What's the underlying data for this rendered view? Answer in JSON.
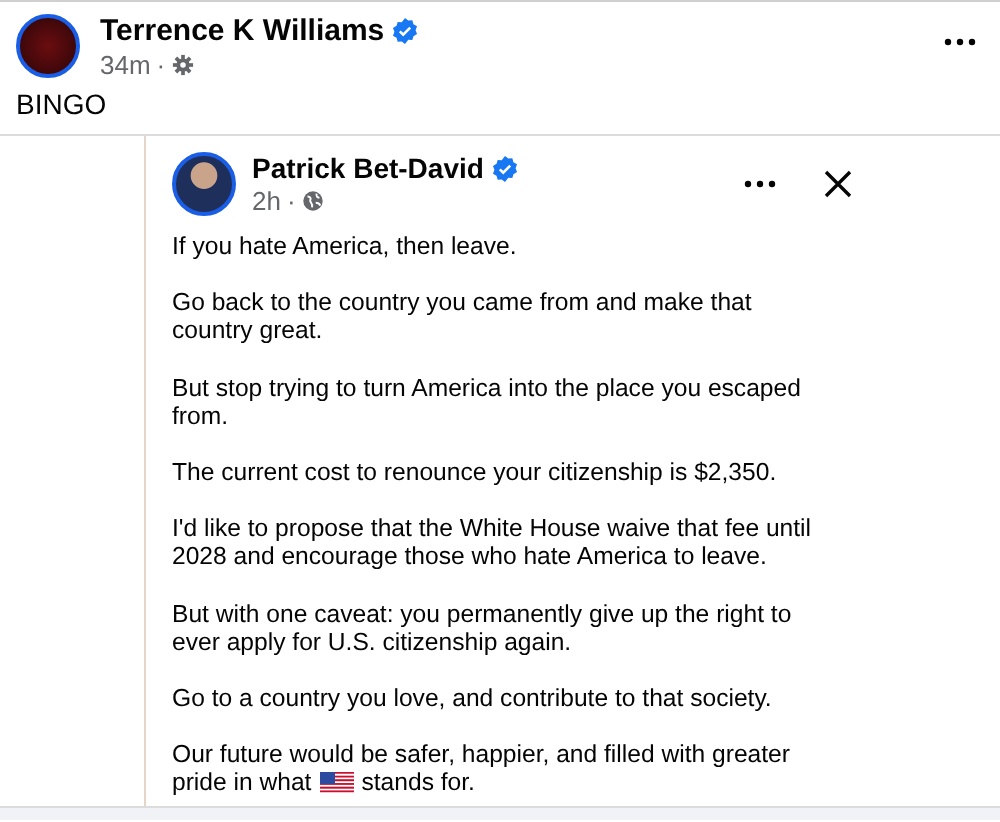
{
  "post": {
    "author": "Terrence K Williams",
    "verified": true,
    "time": "34m",
    "separator": "·",
    "text": "BINGO"
  },
  "shared_post": {
    "author": "Patrick Bet-David",
    "verified": true,
    "time": "2h",
    "separator": "·",
    "paragraphs": [
      {
        "kind": "text",
        "text": "If you hate America, then leave."
      },
      {
        "kind": "text",
        "text": "Go back to the country you came from and make that country great."
      },
      {
        "kind": "text",
        "text": "But stop trying to turn America into the place you escaped from."
      },
      {
        "kind": "text",
        "text": "The current cost to renounce your citizenship is $2,350."
      },
      {
        "kind": "text",
        "text": "I'd like to propose that the White House waive that fee until 2028 and encourage those who hate America to leave."
      },
      {
        "kind": "text",
        "text": "But with one caveat: you permanently give up the right to ever apply for U.S. citizenship again."
      },
      {
        "kind": "text",
        "text": "Go to a country you love, and contribute to that society."
      },
      {
        "kind": "flag",
        "first_line": "Our future would be safer, happier, and filled with greater",
        "before": "pride in what",
        "after": "stands for."
      }
    ]
  }
}
